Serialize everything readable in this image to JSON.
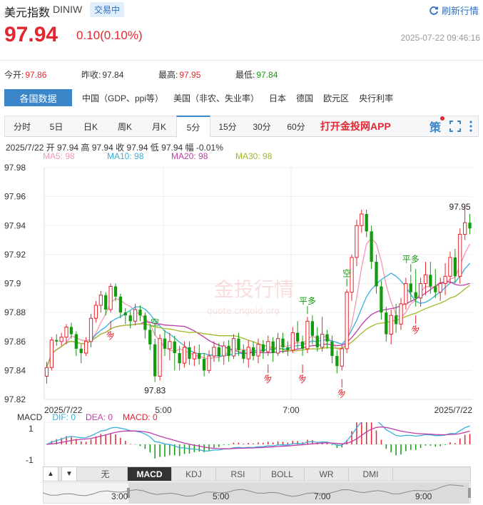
{
  "header": {
    "title": "美元指数",
    "code": "DINIW",
    "status": "交易中",
    "refresh_label": "刷新行情"
  },
  "quote": {
    "price": "97.94",
    "change": "0.10(0.10%)",
    "datetime": "2025-07-22 09:46:16"
  },
  "stats": [
    {
      "label": "今开:",
      "value": "97.86",
      "color": "red"
    },
    {
      "label": "昨收:",
      "value": "97.84",
      "color": "normal"
    },
    {
      "label": "最高:",
      "value": "97.95",
      "color": "red"
    },
    {
      "label": "最低:",
      "value": "97.84",
      "color": "green"
    }
  ],
  "nav": {
    "active": "各国数据",
    "items": [
      "中国（GDP、ppi等）",
      "美国（非农、失业率）",
      "日本",
      "德国",
      "欧元区",
      "央行利率"
    ]
  },
  "tabs": [
    "分时",
    "5日",
    "日K",
    "周K",
    "月K",
    "5分",
    "15分",
    "30分",
    "60分"
  ],
  "selected_tab": "5分",
  "app_label": "打开金投网APP",
  "ohlc_line": "2025/7/22  开 97.94  高 97.94  收 97.94  低 97.94  幅 -0.01%",
  "ma_legend": [
    {
      "label": "MA5: 98",
      "color": "#f29ab2"
    },
    {
      "label": "MA10: 98",
      "color": "#3ab0d9"
    },
    {
      "label": "MA20: 98",
      "color": "#c03da8"
    },
    {
      "label": "MA30: 98",
      "color": "#a4b829"
    }
  ],
  "macd_legend": {
    "title": "MACD",
    "dif": "DIF: 0",
    "dea": "DEA: 0",
    "macd": "MACD: 0"
  },
  "indicator_tabs": [
    "无",
    "MACD",
    "KDJ",
    "RSI",
    "BOLL",
    "WR",
    "DMI"
  ],
  "selected_indicator": "MACD",
  "navigator_labels": [
    "3:00",
    "5:00",
    "7:00",
    "9:00"
  ],
  "colors": {
    "up": "#e3262f",
    "down": "#139b0e",
    "accent": "#3a86c8"
  },
  "chart_data": {
    "type": "candlestick",
    "title": "",
    "y_ticks": [
      "97.98",
      "97.96",
      "97.94",
      "97.92",
      "97.9",
      "97.88",
      "97.86",
      "97.84",
      "97.82"
    ],
    "ylim": [
      97.82,
      97.98
    ],
    "x_ticks": [
      "2025/7/22",
      "5:00",
      "7:00",
      "2025/7/22"
    ],
    "annotations": [
      {
        "text": "97.83",
        "type": "low"
      },
      {
        "text": "97.95",
        "type": "high"
      },
      {
        "text": "空",
        "type": "signal"
      },
      {
        "text": "平多",
        "type": "signal"
      },
      {
        "text": "空",
        "type": "signal"
      },
      {
        "text": "平多",
        "type": "signal"
      },
      {
        "text": "多",
        "type": "signal"
      },
      {
        "text": "多",
        "type": "signal"
      },
      {
        "text": "多",
        "type": "signal"
      },
      {
        "text": "多",
        "type": "signal"
      },
      {
        "text": "多",
        "type": "signal"
      }
    ],
    "macd_ticks": [
      "1",
      "-1"
    ],
    "candles": [
      [
        97.836,
        97.842,
        97.831,
        97.846
      ],
      [
        97.842,
        97.861,
        97.84,
        97.863
      ],
      [
        97.861,
        97.86,
        97.857,
        97.865
      ],
      [
        97.86,
        97.863,
        97.857,
        97.866
      ],
      [
        97.863,
        97.87,
        97.858,
        97.872
      ],
      [
        97.87,
        97.865,
        97.862,
        97.873
      ],
      [
        97.865,
        97.855,
        97.85,
        97.867
      ],
      [
        97.855,
        97.852,
        97.845,
        97.858
      ],
      [
        97.852,
        97.86,
        97.85,
        97.863
      ],
      [
        97.86,
        97.876,
        97.856,
        97.879
      ],
      [
        97.876,
        97.885,
        97.873,
        97.888
      ],
      [
        97.885,
        97.892,
        97.88,
        97.895
      ],
      [
        97.892,
        97.882,
        97.878,
        97.894
      ],
      [
        97.882,
        97.898,
        97.88,
        97.9
      ],
      [
        97.898,
        97.891,
        97.888,
        97.9
      ],
      [
        97.891,
        97.88,
        97.876,
        97.893
      ],
      [
        97.88,
        97.878,
        97.872,
        97.883
      ],
      [
        97.878,
        97.874,
        97.869,
        97.881
      ],
      [
        97.874,
        97.882,
        97.871,
        97.886
      ],
      [
        97.882,
        97.878,
        97.874,
        97.885
      ],
      [
        97.878,
        97.868,
        97.862,
        97.88
      ],
      [
        97.868,
        97.858,
        97.854,
        97.872
      ],
      [
        97.858,
        97.836,
        97.832,
        97.862
      ],
      [
        97.836,
        97.862,
        97.833,
        97.865
      ],
      [
        97.862,
        97.855,
        97.85,
        97.868
      ],
      [
        97.855,
        97.86,
        97.847,
        97.866
      ],
      [
        97.86,
        97.852,
        97.84,
        97.864
      ],
      [
        97.852,
        97.845,
        97.84,
        97.857
      ],
      [
        97.845,
        97.856,
        97.842,
        97.86
      ],
      [
        97.856,
        97.848,
        97.844,
        97.86
      ],
      [
        97.848,
        97.852,
        97.843,
        97.857
      ],
      [
        97.852,
        97.848,
        97.844,
        97.858
      ],
      [
        97.848,
        97.84,
        97.836,
        97.852
      ],
      [
        97.84,
        97.85,
        97.838,
        97.854
      ],
      [
        97.85,
        97.856,
        97.846,
        97.86
      ],
      [
        97.856,
        97.85,
        97.846,
        97.859
      ],
      [
        97.85,
        97.857,
        97.844,
        97.86
      ],
      [
        97.857,
        97.85,
        97.846,
        97.861
      ],
      [
        97.85,
        97.862,
        97.848,
        97.865
      ],
      [
        97.862,
        97.854,
        97.85,
        97.866
      ],
      [
        97.854,
        97.848,
        97.845,
        97.858
      ],
      [
        97.848,
        97.856,
        97.842,
        97.861
      ],
      [
        97.856,
        97.85,
        97.847,
        97.86
      ],
      [
        97.85,
        97.858,
        97.845,
        97.862
      ],
      [
        97.858,
        97.853,
        97.848,
        97.861
      ],
      [
        97.853,
        97.86,
        97.85,
        97.864
      ],
      [
        97.86,
        97.852,
        97.846,
        97.863
      ],
      [
        97.852,
        97.862,
        97.85,
        97.866
      ],
      [
        97.862,
        97.856,
        97.852,
        97.866
      ],
      [
        97.856,
        97.854,
        97.85,
        97.86
      ],
      [
        97.854,
        97.866,
        97.852,
        97.87
      ],
      [
        97.866,
        97.86,
        97.855,
        97.874
      ],
      [
        97.86,
        97.855,
        97.85,
        97.864
      ],
      [
        97.855,
        97.874,
        97.852,
        97.877
      ],
      [
        97.874,
        97.864,
        97.858,
        97.878
      ],
      [
        97.864,
        97.856,
        97.853,
        97.87
      ],
      [
        97.856,
        97.865,
        97.853,
        97.877
      ],
      [
        97.865,
        97.86,
        97.855,
        97.868
      ],
      [
        97.86,
        97.85,
        97.845,
        97.864
      ],
      [
        97.85,
        97.843,
        97.838,
        97.854
      ],
      [
        97.843,
        97.855,
        97.84,
        97.858
      ],
      [
        97.855,
        97.894,
        97.852,
        97.896
      ],
      [
        97.894,
        97.918,
        97.888,
        97.92
      ],
      [
        97.918,
        97.94,
        97.912,
        97.944
      ],
      [
        97.94,
        97.948,
        97.935,
        97.951
      ],
      [
        97.948,
        97.936,
        97.932,
        97.951
      ],
      [
        97.936,
        97.915,
        97.91,
        97.94
      ],
      [
        97.915,
        97.898,
        97.893,
        97.92
      ],
      [
        97.898,
        97.88,
        97.875,
        97.902
      ],
      [
        97.88,
        97.865,
        97.86,
        97.884
      ],
      [
        97.865,
        97.878,
        97.858,
        97.882
      ],
      [
        97.878,
        97.872,
        97.866,
        97.886
      ],
      [
        97.872,
        97.886,
        97.868,
        97.89
      ],
      [
        97.886,
        97.9,
        97.882,
        97.904
      ],
      [
        97.9,
        97.894,
        97.888,
        97.906
      ],
      [
        97.894,
        97.89,
        97.884,
        97.91
      ],
      [
        97.89,
        97.9,
        97.884,
        97.904
      ],
      [
        97.9,
        97.906,
        97.892,
        97.915
      ],
      [
        97.906,
        97.898,
        97.893,
        97.915
      ],
      [
        97.898,
        97.894,
        97.89,
        97.91
      ],
      [
        97.894,
        97.9,
        97.888,
        97.904
      ],
      [
        97.9,
        97.905,
        97.892,
        97.914
      ],
      [
        97.905,
        97.918,
        97.9,
        97.922
      ],
      [
        97.918,
        97.905,
        97.9,
        97.924
      ],
      [
        97.905,
        97.934,
        97.9,
        97.938
      ],
      [
        97.934,
        97.942,
        97.93,
        97.954
      ],
      [
        97.942,
        97.938,
        97.934,
        97.948
      ]
    ]
  }
}
